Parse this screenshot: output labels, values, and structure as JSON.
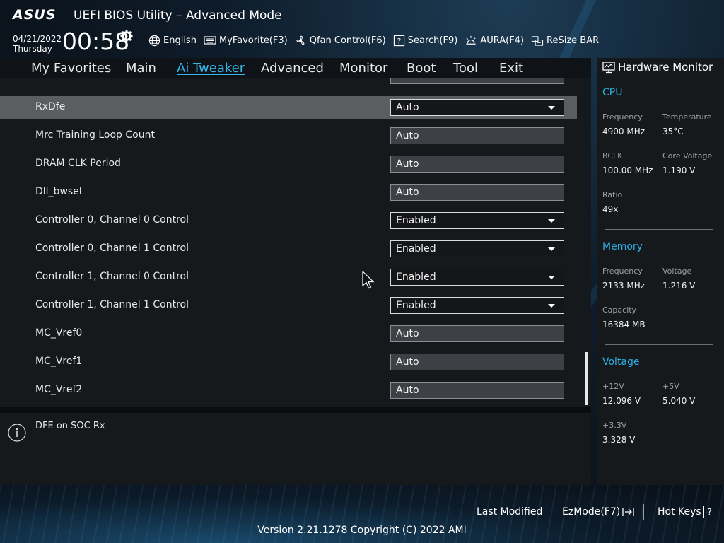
{
  "header": {
    "logo": "ASUS",
    "title": "UEFI BIOS Utility – Advanced Mode",
    "date": "04/21/2022",
    "day": "Thursday",
    "time": "00:58",
    "toolbar": [
      {
        "label": "English",
        "icon": "globe-icon"
      },
      {
        "label": "MyFavorite(F3)",
        "icon": "keyboard-icon"
      },
      {
        "label": "Qfan Control(F6)",
        "icon": "fan-icon"
      },
      {
        "label": "Search(F9)",
        "icon": "search-help-icon"
      },
      {
        "label": "AURA(F4)",
        "icon": "aura-light-icon"
      },
      {
        "label": "ReSize BAR",
        "icon": "resize-bar-icon"
      }
    ]
  },
  "nav": {
    "tabs": [
      "My Favorites",
      "Main",
      "Ai Tweaker",
      "Advanced",
      "Monitor",
      "Boot",
      "Tool",
      "Exit"
    ],
    "active": "Ai Tweaker"
  },
  "settings": [
    {
      "label": "RxDfe",
      "value": "Auto",
      "type": "dropdown",
      "selected": true
    },
    {
      "label": "Mrc Training Loop Count",
      "value": "Auto",
      "type": "input"
    },
    {
      "label": "DRAM CLK Period",
      "value": "Auto",
      "type": "input"
    },
    {
      "label": "Dll_bwsel",
      "value": "Auto",
      "type": "input"
    },
    {
      "label": "Controller 0, Channel 0 Control",
      "value": "Enabled",
      "type": "dropdown"
    },
    {
      "label": "Controller 0, Channel 1 Control",
      "value": "Enabled",
      "type": "dropdown"
    },
    {
      "label": "Controller 1, Channel 0 Control",
      "value": "Enabled",
      "type": "dropdown"
    },
    {
      "label": "Controller 1, Channel 1 Control",
      "value": "Enabled",
      "type": "dropdown"
    },
    {
      "label": "MC_Vref0",
      "value": "Auto",
      "type": "input"
    },
    {
      "label": "MC_Vref1",
      "value": "Auto",
      "type": "input"
    },
    {
      "label": "MC_Vref2",
      "value": "Auto",
      "type": "input"
    }
  ],
  "partial_top_field_value": "Auto",
  "help": {
    "text": "DFE on SOC Rx"
  },
  "hardware_monitor": {
    "title": "Hardware Monitor",
    "cpu": {
      "heading": "CPU",
      "frequency_label": "Frequency",
      "frequency": "4900 MHz",
      "temperature_label": "Temperature",
      "temperature": "35°C",
      "bclk_label": "BCLK",
      "bclk": "100.00 MHz",
      "core_voltage_label": "Core Voltage",
      "core_voltage": "1.190 V",
      "ratio_label": "Ratio",
      "ratio": "49x"
    },
    "memory": {
      "heading": "Memory",
      "frequency_label": "Frequency",
      "frequency": "2133 MHz",
      "voltage_label": "Voltage",
      "voltage": "1.216 V",
      "capacity_label": "Capacity",
      "capacity": "16384 MB"
    },
    "voltage": {
      "heading": "Voltage",
      "v12_label": "+12V",
      "v12": "12.096 V",
      "v5_label": "+5V",
      "v5": "5.040 V",
      "v33_label": "+3.3V",
      "v33": "3.328 V"
    }
  },
  "footer": {
    "last_modified": "Last Modified",
    "ezmode": "EzMode(F7)",
    "hotkeys": "Hot Keys",
    "hotkeys_key": "?",
    "version": "Version 2.21.1278 Copyright (C) 2022 AMI"
  },
  "colors": {
    "accent": "#36b6e8",
    "panel": "#16191c",
    "selected_row": "#5b5e61"
  }
}
